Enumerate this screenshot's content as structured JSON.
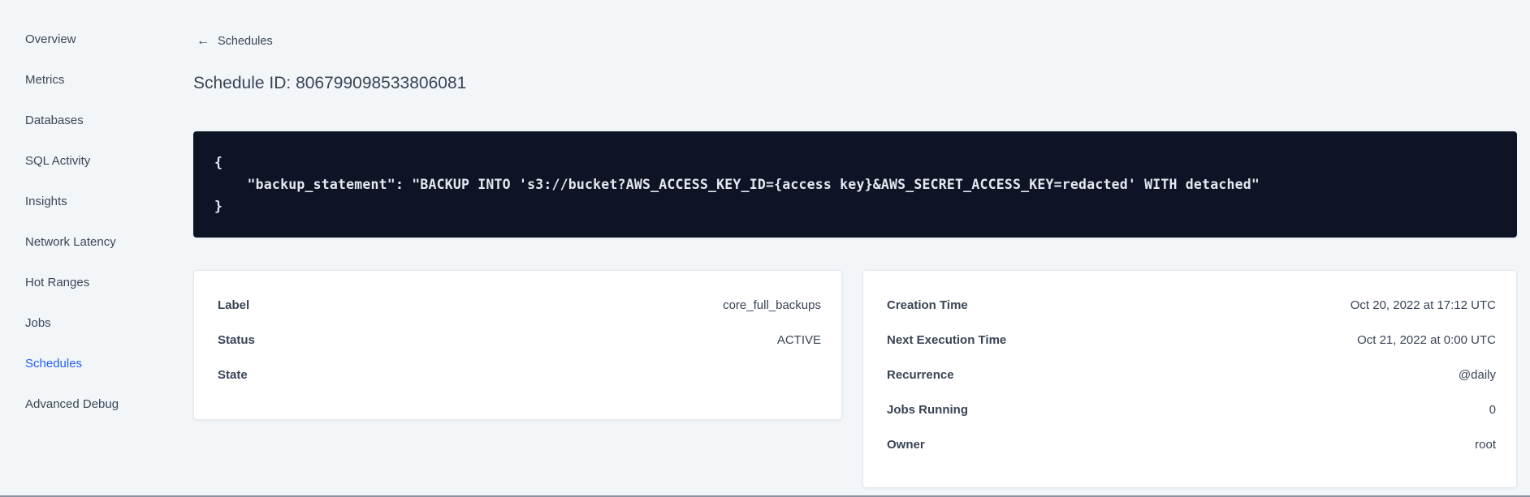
{
  "sidebar": {
    "items": [
      {
        "label": "Overview"
      },
      {
        "label": "Metrics"
      },
      {
        "label": "Databases"
      },
      {
        "label": "SQL Activity"
      },
      {
        "label": "Insights"
      },
      {
        "label": "Network Latency"
      },
      {
        "label": "Hot Ranges"
      },
      {
        "label": "Jobs"
      },
      {
        "label": "Schedules",
        "active": true
      },
      {
        "label": "Advanced Debug"
      }
    ],
    "active_color": "#2161f4"
  },
  "header": {
    "back_icon": "←",
    "back_label": "Schedules",
    "title": "Schedule ID: 806799098533806081"
  },
  "code_block": {
    "background": "#0d1425",
    "lines": [
      "{",
      "    \"backup_statement\": \"BACKUP INTO 's3://bucket?AWS_ACCESS_KEY_ID={access key}&AWS_SECRET_ACCESS_KEY=redacted' WITH detached\"",
      "}"
    ]
  },
  "cards": {
    "left": {
      "rows": [
        {
          "label": "Label",
          "value": "core_full_backups"
        },
        {
          "label": "Status",
          "value": "ACTIVE"
        },
        {
          "label": "State",
          "value": ""
        }
      ]
    },
    "right": {
      "rows": [
        {
          "label": "Creation Time",
          "value": "Oct 20, 2022 at 17:12 UTC"
        },
        {
          "label": "Next Execution Time",
          "value": "Oct 21, 2022 at 0:00 UTC"
        },
        {
          "label": "Recurrence",
          "value": "@daily"
        },
        {
          "label": "Jobs Running",
          "value": "0"
        },
        {
          "label": "Owner",
          "value": "root"
        }
      ]
    }
  }
}
